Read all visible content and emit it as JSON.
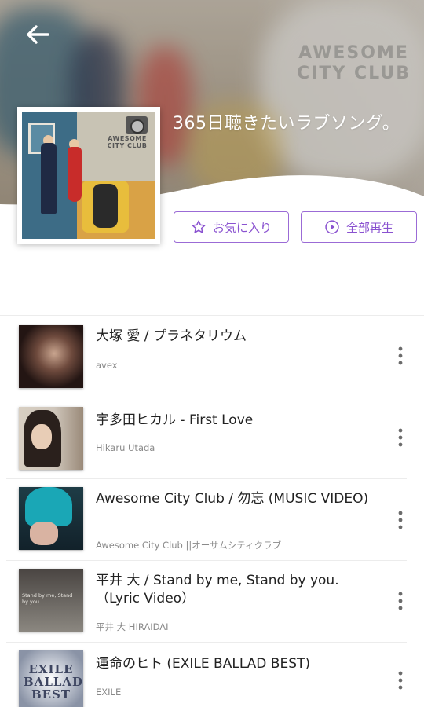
{
  "header": {
    "title": "365日聴きたいラブソング。",
    "background_logo_text": "AWESOME CITY CLUB",
    "artwork_logo_text": "AWESOME CITY CLUB"
  },
  "actions": {
    "favorite_label": "お気に入り",
    "play_all_label": "全部再生"
  },
  "colors": {
    "accent": "#8a52d0",
    "text_primary": "#222222",
    "text_secondary": "#8a8a8a"
  },
  "tracks": [
    {
      "title": "大塚 愛 / プラネタリウム",
      "artist": "avex",
      "thumb_caption": ""
    },
    {
      "title": "宇多田ヒカル - First Love",
      "artist": "Hikaru Utada",
      "thumb_caption": ""
    },
    {
      "title": "Awesome City Club / 勿忘 (MUSIC VIDEO)",
      "artist": "Awesome City Club ||オーサムシティクラブ",
      "thumb_caption": ""
    },
    {
      "title": "平井 大 / Stand by me, Stand by you.（Lyric Video）",
      "artist": "平井 大 HIRAIDAI",
      "thumb_caption": "Stand by me, Stand by you."
    },
    {
      "title": "運命のヒト (EXILE BALLAD BEST)",
      "artist": "EXILE",
      "thumb_caption": "EXILE BALLAD BEST"
    }
  ]
}
